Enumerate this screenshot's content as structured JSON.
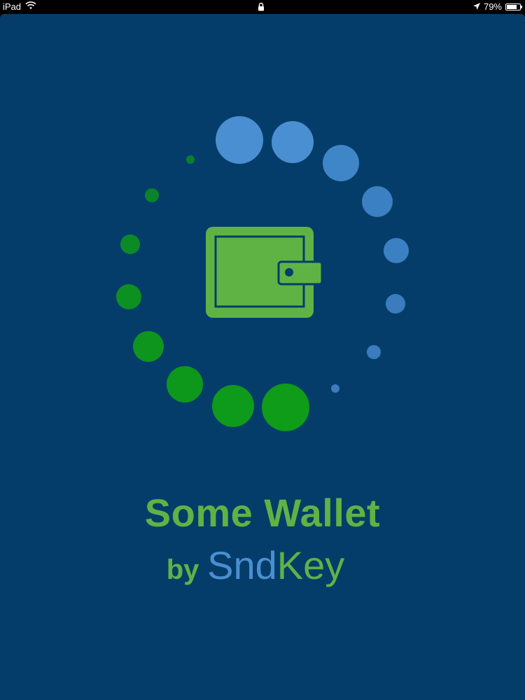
{
  "status_bar": {
    "device": "iPad",
    "battery_percent": "79%",
    "battery_level": 0.79,
    "icons": [
      "wifi-icon",
      "lock-icon",
      "location-arrow-icon",
      "battery-icon"
    ]
  },
  "splash": {
    "app_name": "Some Wallet",
    "by_label": "by",
    "company_part1": "Snd",
    "company_part2": "Key",
    "colors": {
      "background": "#053d6a",
      "green": "#5fb345",
      "blue": "#4a8fd1",
      "dot_green": "#0e9a1a",
      "dot_blue": "#4a8fd1"
    },
    "center_icon": "wallet-icon",
    "loading_indicator": "loading-spinner-dots"
  }
}
